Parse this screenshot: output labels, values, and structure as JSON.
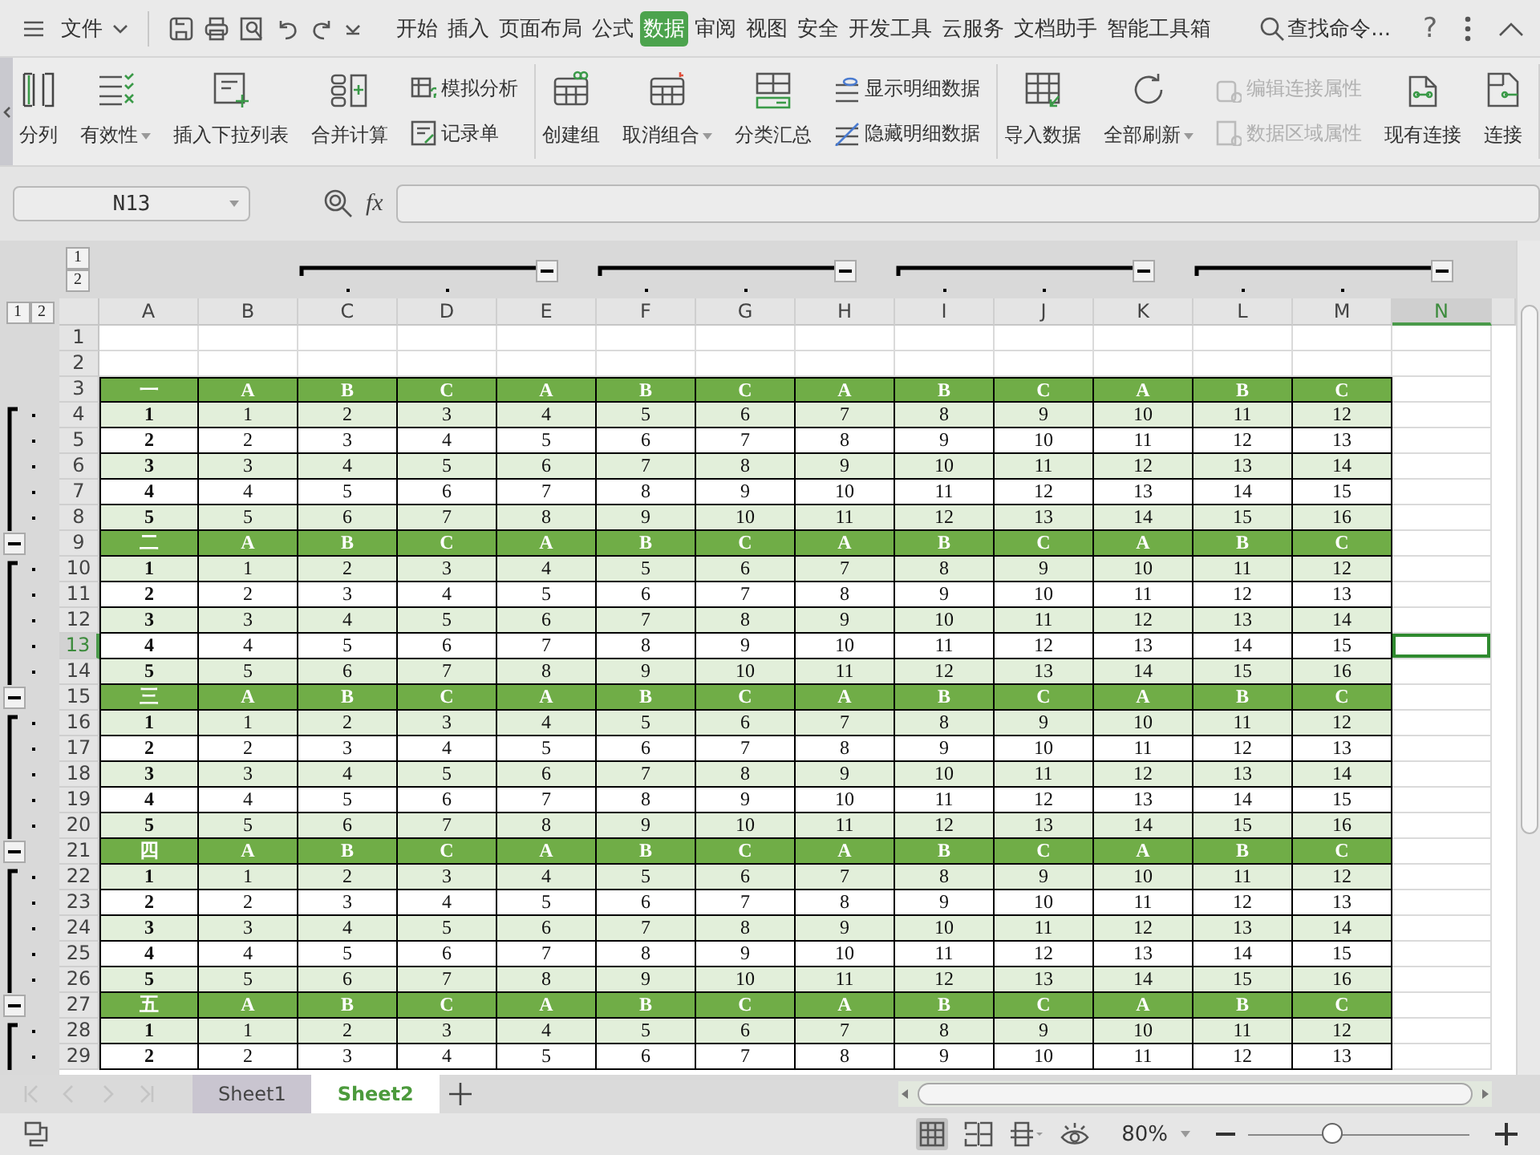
{
  "menu_bar": {
    "file_label": "文件",
    "tabs": [
      {
        "label": "开始",
        "selected": false
      },
      {
        "label": "插入",
        "selected": false
      },
      {
        "label": "页面布局",
        "selected": false
      },
      {
        "label": "公式",
        "selected": false
      },
      {
        "label": "数据",
        "selected": true
      },
      {
        "label": "审阅",
        "selected": false
      },
      {
        "label": "视图",
        "selected": false
      },
      {
        "label": "安全",
        "selected": false
      },
      {
        "label": "开发工具",
        "selected": false
      },
      {
        "label": "云服务",
        "selected": false
      },
      {
        "label": "文档助手",
        "selected": false
      },
      {
        "label": "智能工具箱",
        "selected": false
      }
    ],
    "search_label": "查找命令...",
    "help_label": "?"
  },
  "ribbon": {
    "groups": [
      {
        "items": [
          {
            "kind": "large",
            "label": "分列",
            "dropdown": false
          },
          {
            "kind": "large",
            "label": "有效性",
            "dropdown": true
          },
          {
            "kind": "large",
            "label": "插入下拉列表",
            "dropdown": false
          },
          {
            "kind": "large",
            "label": "合并计算",
            "dropdown": false
          },
          {
            "kind": "stack",
            "items": [
              {
                "label": "模拟分析",
                "disabled": false
              },
              {
                "label": "记录单",
                "disabled": false
              }
            ]
          }
        ]
      },
      {
        "items": [
          {
            "kind": "large",
            "label": "创建组",
            "dropdown": false
          },
          {
            "kind": "large",
            "label": "取消组合",
            "dropdown": true
          },
          {
            "kind": "large",
            "label": "分类汇总",
            "dropdown": false
          },
          {
            "kind": "stack",
            "items": [
              {
                "label": "显示明细数据",
                "disabled": false
              },
              {
                "label": "隐藏明细数据",
                "disabled": false
              }
            ]
          }
        ]
      },
      {
        "items": [
          {
            "kind": "large",
            "label": "导入数据",
            "dropdown": false
          },
          {
            "kind": "large",
            "label": "全部刷新",
            "dropdown": true
          },
          {
            "kind": "stack",
            "items": [
              {
                "label": "编辑连接属性",
                "disabled": true
              },
              {
                "label": "数据区域属性",
                "disabled": true
              }
            ]
          },
          {
            "kind": "large",
            "label": "现有连接",
            "dropdown": false
          },
          {
            "kind": "large",
            "label": "连接",
            "dropdown": false
          }
        ]
      }
    ]
  },
  "formula_bar": {
    "name_box": "N13",
    "function_label": "fx"
  },
  "outline_levels": {
    "columns": [
      "1",
      "2"
    ],
    "rows": [
      "1",
      "2"
    ]
  },
  "columns": [
    {
      "label": "A",
      "selected": false,
      "grouped": false,
      "collapse_button": false
    },
    {
      "label": "B",
      "selected": false,
      "grouped": false,
      "collapse_button": false
    },
    {
      "label": "C",
      "selected": false,
      "grouped": true,
      "collapse_button": false
    },
    {
      "label": "D",
      "selected": false,
      "grouped": true,
      "collapse_button": false
    },
    {
      "label": "E",
      "selected": false,
      "grouped": false,
      "collapse_button": true
    },
    {
      "label": "F",
      "selected": false,
      "grouped": true,
      "collapse_button": false
    },
    {
      "label": "G",
      "selected": false,
      "grouped": true,
      "collapse_button": false
    },
    {
      "label": "H",
      "selected": false,
      "grouped": false,
      "collapse_button": true
    },
    {
      "label": "I",
      "selected": false,
      "grouped": true,
      "collapse_button": false
    },
    {
      "label": "J",
      "selected": false,
      "grouped": true,
      "collapse_button": false
    },
    {
      "label": "K",
      "selected": false,
      "grouped": false,
      "collapse_button": true
    },
    {
      "label": "L",
      "selected": false,
      "grouped": true,
      "collapse_button": false
    },
    {
      "label": "M",
      "selected": false,
      "grouped": true,
      "collapse_button": false
    },
    {
      "label": "N",
      "selected": true,
      "grouped": false,
      "collapse_button": true
    }
  ],
  "rows": [
    {
      "number": "1",
      "selected": false,
      "kind": "blank",
      "grouped": false,
      "collapse_button": false
    },
    {
      "number": "2",
      "selected": false,
      "kind": "blank",
      "grouped": false,
      "collapse_button": false
    },
    {
      "number": "3",
      "selected": false,
      "kind": "header",
      "grouped": false,
      "collapse_button": false,
      "cells": [
        "一",
        "A",
        "B",
        "C",
        "A",
        "B",
        "C",
        "A",
        "B",
        "C",
        "A",
        "B",
        "C"
      ]
    },
    {
      "number": "4",
      "selected": false,
      "kind": "data",
      "shaded": true,
      "grouped": true,
      "collapse_button": false,
      "cells": [
        "1",
        "1",
        "2",
        "3",
        "4",
        "5",
        "6",
        "7",
        "8",
        "9",
        "10",
        "11",
        "12"
      ]
    },
    {
      "number": "5",
      "selected": false,
      "kind": "data",
      "shaded": false,
      "grouped": true,
      "collapse_button": false,
      "cells": [
        "2",
        "2",
        "3",
        "4",
        "5",
        "6",
        "7",
        "8",
        "9",
        "10",
        "11",
        "12",
        "13"
      ]
    },
    {
      "number": "6",
      "selected": false,
      "kind": "data",
      "shaded": true,
      "grouped": true,
      "collapse_button": false,
      "cells": [
        "3",
        "3",
        "4",
        "5",
        "6",
        "7",
        "8",
        "9",
        "10",
        "11",
        "12",
        "13",
        "14"
      ]
    },
    {
      "number": "7",
      "selected": false,
      "kind": "data",
      "shaded": false,
      "grouped": true,
      "collapse_button": false,
      "cells": [
        "4",
        "4",
        "5",
        "6",
        "7",
        "8",
        "9",
        "10",
        "11",
        "12",
        "13",
        "14",
        "15"
      ]
    },
    {
      "number": "8",
      "selected": false,
      "kind": "data",
      "shaded": true,
      "grouped": true,
      "collapse_button": false,
      "cells": [
        "5",
        "5",
        "6",
        "7",
        "8",
        "9",
        "10",
        "11",
        "12",
        "13",
        "14",
        "15",
        "16"
      ]
    },
    {
      "number": "9",
      "selected": false,
      "kind": "header",
      "grouped": false,
      "collapse_button": true,
      "cells": [
        "二",
        "A",
        "B",
        "C",
        "A",
        "B",
        "C",
        "A",
        "B",
        "C",
        "A",
        "B",
        "C"
      ]
    },
    {
      "number": "10",
      "selected": false,
      "kind": "data",
      "shaded": true,
      "grouped": true,
      "collapse_button": false,
      "cells": [
        "1",
        "1",
        "2",
        "3",
        "4",
        "5",
        "6",
        "7",
        "8",
        "9",
        "10",
        "11",
        "12"
      ]
    },
    {
      "number": "11",
      "selected": false,
      "kind": "data",
      "shaded": false,
      "grouped": true,
      "collapse_button": false,
      "cells": [
        "2",
        "2",
        "3",
        "4",
        "5",
        "6",
        "7",
        "8",
        "9",
        "10",
        "11",
        "12",
        "13"
      ]
    },
    {
      "number": "12",
      "selected": false,
      "kind": "data",
      "shaded": true,
      "grouped": true,
      "collapse_button": false,
      "cells": [
        "3",
        "3",
        "4",
        "5",
        "6",
        "7",
        "8",
        "9",
        "10",
        "11",
        "12",
        "13",
        "14"
      ]
    },
    {
      "number": "13",
      "selected": true,
      "kind": "data",
      "shaded": false,
      "grouped": true,
      "collapse_button": false,
      "cells": [
        "4",
        "4",
        "5",
        "6",
        "7",
        "8",
        "9",
        "10",
        "11",
        "12",
        "13",
        "14",
        "15"
      ]
    },
    {
      "number": "14",
      "selected": false,
      "kind": "data",
      "shaded": true,
      "grouped": true,
      "collapse_button": false,
      "cells": [
        "5",
        "5",
        "6",
        "7",
        "8",
        "9",
        "10",
        "11",
        "12",
        "13",
        "14",
        "15",
        "16"
      ]
    },
    {
      "number": "15",
      "selected": false,
      "kind": "header",
      "grouped": false,
      "collapse_button": true,
      "cells": [
        "三",
        "A",
        "B",
        "C",
        "A",
        "B",
        "C",
        "A",
        "B",
        "C",
        "A",
        "B",
        "C"
      ]
    },
    {
      "number": "16",
      "selected": false,
      "kind": "data",
      "shaded": true,
      "grouped": true,
      "collapse_button": false,
      "cells": [
        "1",
        "1",
        "2",
        "3",
        "4",
        "5",
        "6",
        "7",
        "8",
        "9",
        "10",
        "11",
        "12"
      ]
    },
    {
      "number": "17",
      "selected": false,
      "kind": "data",
      "shaded": false,
      "grouped": true,
      "collapse_button": false,
      "cells": [
        "2",
        "2",
        "3",
        "4",
        "5",
        "6",
        "7",
        "8",
        "9",
        "10",
        "11",
        "12",
        "13"
      ]
    },
    {
      "number": "18",
      "selected": false,
      "kind": "data",
      "shaded": true,
      "grouped": true,
      "collapse_button": false,
      "cells": [
        "3",
        "3",
        "4",
        "5",
        "6",
        "7",
        "8",
        "9",
        "10",
        "11",
        "12",
        "13",
        "14"
      ]
    },
    {
      "number": "19",
      "selected": false,
      "kind": "data",
      "shaded": false,
      "grouped": true,
      "collapse_button": false,
      "cells": [
        "4",
        "4",
        "5",
        "6",
        "7",
        "8",
        "9",
        "10",
        "11",
        "12",
        "13",
        "14",
        "15"
      ]
    },
    {
      "number": "20",
      "selected": false,
      "kind": "data",
      "shaded": true,
      "grouped": true,
      "collapse_button": false,
      "cells": [
        "5",
        "5",
        "6",
        "7",
        "8",
        "9",
        "10",
        "11",
        "12",
        "13",
        "14",
        "15",
        "16"
      ]
    },
    {
      "number": "21",
      "selected": false,
      "kind": "header",
      "grouped": false,
      "collapse_button": true,
      "cells": [
        "四",
        "A",
        "B",
        "C",
        "A",
        "B",
        "C",
        "A",
        "B",
        "C",
        "A",
        "B",
        "C"
      ]
    },
    {
      "number": "22",
      "selected": false,
      "kind": "data",
      "shaded": true,
      "grouped": true,
      "collapse_button": false,
      "cells": [
        "1",
        "1",
        "2",
        "3",
        "4",
        "5",
        "6",
        "7",
        "8",
        "9",
        "10",
        "11",
        "12"
      ]
    },
    {
      "number": "23",
      "selected": false,
      "kind": "data",
      "shaded": false,
      "grouped": true,
      "collapse_button": false,
      "cells": [
        "2",
        "2",
        "3",
        "4",
        "5",
        "6",
        "7",
        "8",
        "9",
        "10",
        "11",
        "12",
        "13"
      ]
    },
    {
      "number": "24",
      "selected": false,
      "kind": "data",
      "shaded": true,
      "grouped": true,
      "collapse_button": false,
      "cells": [
        "3",
        "3",
        "4",
        "5",
        "6",
        "7",
        "8",
        "9",
        "10",
        "11",
        "12",
        "13",
        "14"
      ]
    },
    {
      "number": "25",
      "selected": false,
      "kind": "data",
      "shaded": false,
      "grouped": true,
      "collapse_button": false,
      "cells": [
        "4",
        "4",
        "5",
        "6",
        "7",
        "8",
        "9",
        "10",
        "11",
        "12",
        "13",
        "14",
        "15"
      ]
    },
    {
      "number": "26",
      "selected": false,
      "kind": "data",
      "shaded": true,
      "grouped": true,
      "collapse_button": false,
      "cells": [
        "5",
        "5",
        "6",
        "7",
        "8",
        "9",
        "10",
        "11",
        "12",
        "13",
        "14",
        "15",
        "16"
      ]
    },
    {
      "number": "27",
      "selected": false,
      "kind": "header",
      "grouped": false,
      "collapse_button": true,
      "cells": [
        "五",
        "A",
        "B",
        "C",
        "A",
        "B",
        "C",
        "A",
        "B",
        "C",
        "A",
        "B",
        "C"
      ]
    },
    {
      "number": "28",
      "selected": false,
      "kind": "data",
      "shaded": true,
      "grouped": true,
      "collapse_button": false,
      "cells": [
        "1",
        "1",
        "2",
        "3",
        "4",
        "5",
        "6",
        "7",
        "8",
        "9",
        "10",
        "11",
        "12"
      ]
    },
    {
      "number": "29",
      "selected": false,
      "kind": "data",
      "shaded": false,
      "grouped": true,
      "collapse_button": false,
      "cells": [
        "2",
        "2",
        "3",
        "4",
        "5",
        "6",
        "7",
        "8",
        "9",
        "10",
        "11",
        "12",
        "13"
      ]
    }
  ],
  "sheet_tabs": [
    {
      "label": "Sheet1",
      "selected": false
    },
    {
      "label": "Sheet2",
      "selected": true
    }
  ],
  "status_bar": {
    "zoom": "80%",
    "zoom_slider": {
      "level": 0.38
    }
  }
}
